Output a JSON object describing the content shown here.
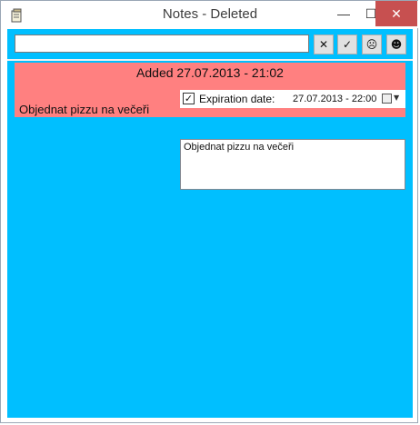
{
  "window": {
    "title": "Notes - Deleted",
    "minimize_icon": "minimize-icon",
    "maximize_icon": "maximize-icon",
    "close_icon": "close-icon",
    "minimize_glyph": "—",
    "maximize_glyph": "☐",
    "close_glyph": "✕"
  },
  "toolbar": {
    "search_value": "",
    "clear_glyph": "✕",
    "confirm_glyph": "✓",
    "sad_glyph": "☹",
    "happy_glyph": "☻"
  },
  "note": {
    "added": "Added 27.07.2013 - 21:02",
    "title": "Objednat pizzu na večeři",
    "expiration_checked": true,
    "expiration_check_glyph": "✓",
    "expiration_label": "Expiration date:",
    "expiration_value": "27.07.2013 - 22:00",
    "dropdown_glyph": "▼",
    "body": "Objednat pizzu na večeři"
  },
  "colors": {
    "toolbar_bg": "#00bfff",
    "note_bg": "#ff8080",
    "close_button": "#c75050"
  }
}
